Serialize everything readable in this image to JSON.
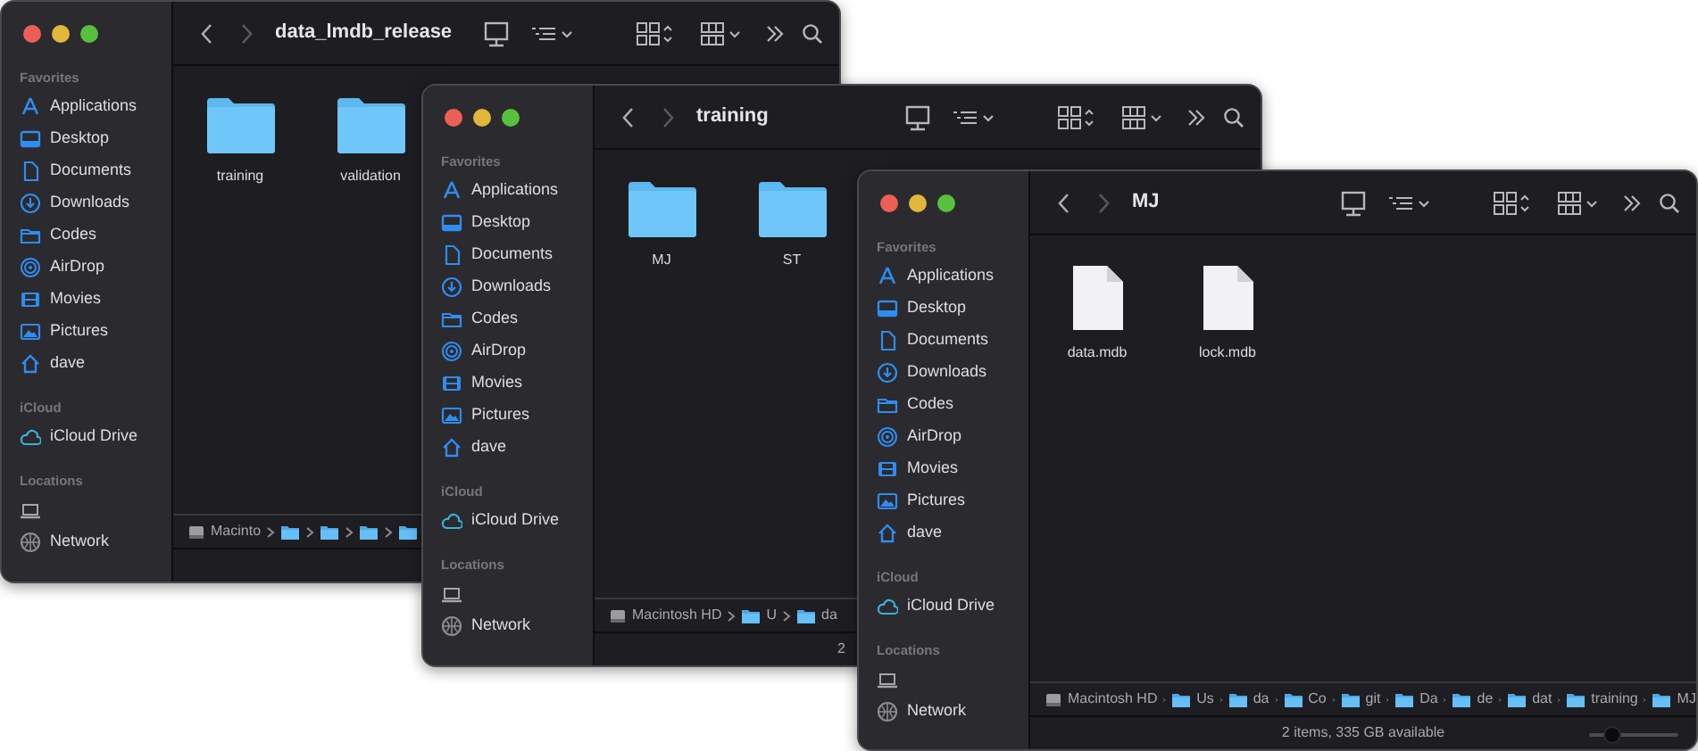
{
  "windows": [
    {
      "title": "data_lmdb_release",
      "sidebar": [
        {
          "heading": "Favorites",
          "items": [
            {
              "label": "Applications",
              "kind": "applications"
            },
            {
              "label": "Desktop",
              "kind": "desktop"
            },
            {
              "label": "Documents",
              "kind": "documents"
            },
            {
              "label": "Downloads",
              "kind": "downloads"
            },
            {
              "label": "Codes",
              "kind": "folder"
            },
            {
              "label": "AirDrop",
              "kind": "airdrop"
            },
            {
              "label": "Movies",
              "kind": "movies"
            },
            {
              "label": "Pictures",
              "kind": "pictures"
            },
            {
              "label": "dave",
              "kind": "home"
            }
          ]
        },
        {
          "heading": "iCloud",
          "items": [
            {
              "label": "iCloud Drive",
              "kind": "cloud"
            }
          ]
        },
        {
          "heading": "Locations",
          "items": [
            {
              "kind": "computer"
            },
            {
              "label": "Network",
              "kind": "network"
            }
          ]
        }
      ],
      "items": [
        {
          "name": "training",
          "kind": "folder"
        },
        {
          "name": "validation",
          "kind": "folder"
        }
      ],
      "path": [
        {
          "label": "Macinto",
          "kind": "disk"
        },
        {
          "kind": "folder"
        },
        {
          "kind": "folder"
        },
        {
          "kind": "folder"
        },
        {
          "kind": "folder"
        }
      ]
    },
    {
      "title": "training",
      "sidebar": [
        {
          "heading": "Favorites",
          "items": [
            {
              "label": "Applications",
              "kind": "applications"
            },
            {
              "label": "Desktop",
              "kind": "desktop"
            },
            {
              "label": "Documents",
              "kind": "documents"
            },
            {
              "label": "Downloads",
              "kind": "downloads"
            },
            {
              "label": "Codes",
              "kind": "folder"
            },
            {
              "label": "AirDrop",
              "kind": "airdrop"
            },
            {
              "label": "Movies",
              "kind": "movies"
            },
            {
              "label": "Pictures",
              "kind": "pictures"
            },
            {
              "label": "dave",
              "kind": "home"
            }
          ]
        },
        {
          "heading": "iCloud",
          "items": [
            {
              "label": "iCloud Drive",
              "kind": "cloud"
            }
          ]
        },
        {
          "heading": "Locations",
          "items": [
            {
              "kind": "computer"
            },
            {
              "label": "Network",
              "kind": "network"
            }
          ]
        }
      ],
      "items": [
        {
          "name": "MJ",
          "kind": "folder"
        },
        {
          "name": "ST",
          "kind": "folder"
        }
      ],
      "path": [
        {
          "label": "Macintosh HD",
          "kind": "disk"
        },
        {
          "label": "U",
          "kind": "folder"
        },
        {
          "label": "da",
          "kind": "folder"
        }
      ],
      "status": "2"
    },
    {
      "title": "MJ",
      "sidebar": [
        {
          "heading": "Favorites",
          "items": [
            {
              "label": "Applications",
              "kind": "applications"
            },
            {
              "label": "Desktop",
              "kind": "desktop"
            },
            {
              "label": "Documents",
              "kind": "documents"
            },
            {
              "label": "Downloads",
              "kind": "downloads"
            },
            {
              "label": "Codes",
              "kind": "folder"
            },
            {
              "label": "AirDrop",
              "kind": "airdrop"
            },
            {
              "label": "Movies",
              "kind": "movies"
            },
            {
              "label": "Pictures",
              "kind": "pictures"
            },
            {
              "label": "dave",
              "kind": "home"
            }
          ]
        },
        {
          "heading": "iCloud",
          "items": [
            {
              "label": "iCloud Drive",
              "kind": "cloud"
            }
          ]
        },
        {
          "heading": "Locations",
          "items": [
            {
              "kind": "computer"
            },
            {
              "label": "Network",
              "kind": "network"
            }
          ]
        }
      ],
      "items": [
        {
          "name": "data.mdb",
          "kind": "file"
        },
        {
          "name": "lock.mdb",
          "kind": "file"
        }
      ],
      "path": [
        {
          "label": "Macintosh HD",
          "kind": "disk"
        },
        {
          "label": "Us",
          "kind": "folder"
        },
        {
          "label": "da",
          "kind": "folder"
        },
        {
          "label": "Co",
          "kind": "folder"
        },
        {
          "label": "git",
          "kind": "folder"
        },
        {
          "label": "Da",
          "kind": "folder"
        },
        {
          "label": "de",
          "kind": "folder"
        },
        {
          "label": "dat",
          "kind": "folder"
        },
        {
          "label": "training",
          "kind": "folder"
        },
        {
          "label": "MJ",
          "kind": "folder"
        }
      ],
      "status": "2 items, 335 GB available",
      "zoom_slider": {
        "level": 0.26
      }
    }
  ]
}
